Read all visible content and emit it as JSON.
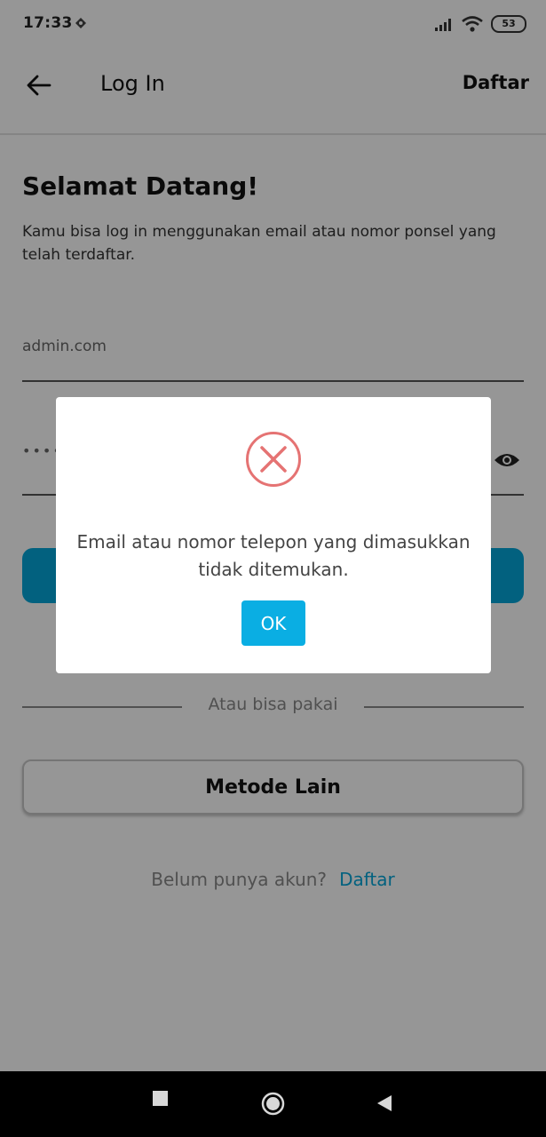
{
  "status_bar": {
    "time": "17:33",
    "battery": "53"
  },
  "app_bar": {
    "title": "Log In",
    "register_action": "Daftar"
  },
  "welcome": {
    "title": "Selamat Datang!",
    "subtitle": "Kamu bisa log in menggunakan email atau nomor ponsel yang telah terdaftar."
  },
  "form": {
    "email_value": "admin.com",
    "password_masked": "••••"
  },
  "divider": {
    "text": "Atau bisa pakai"
  },
  "other_method": {
    "label": "Metode Lain"
  },
  "register": {
    "question": "Belum punya akun?",
    "link": "Daftar"
  },
  "dialog": {
    "message": "Email atau nomor telepon yang dimasukkan tidak ditemukan.",
    "ok_label": "OK"
  },
  "colors": {
    "accent": "#05a6d8",
    "error": "#e57373",
    "overlay": "rgba(0,0,0,0.41)"
  }
}
